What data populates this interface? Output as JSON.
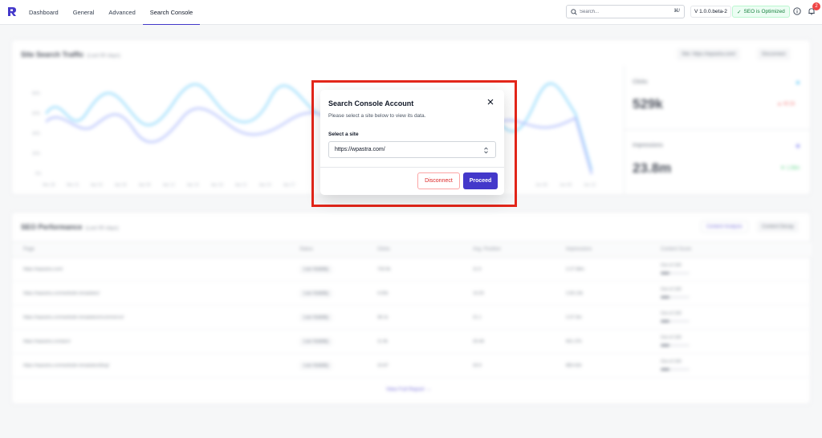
{
  "nav": {
    "tabs": [
      {
        "label": "Dashboard"
      },
      {
        "label": "General"
      },
      {
        "label": "Advanced"
      },
      {
        "label": "Search Console"
      }
    ],
    "search_placeholder": "Search...",
    "search_shortcut": "⌘/",
    "version": "V 1.0.0.beta-2",
    "seo_status": "SEO is Optimized",
    "notification_count": "2",
    "accent_color": "#4338ca"
  },
  "traffic": {
    "title": "Site Search Traffic",
    "subtitle": "(Last 90 days)",
    "site_pill": "Site: https://wpastra.com/",
    "disconnect_pill": "Disconnect",
    "y_ticks": [
      "80%",
      "60%",
      "40%",
      "20%",
      "0%"
    ],
    "x_ticks": [
      "Mar 28",
      "Mar 31",
      "Apr 03",
      "Apr 06",
      "Apr 09",
      "Apr 12",
      "Apr 15",
      "Apr 18",
      "Apr 21",
      "Apr 24",
      "Apr 27",
      "Jun 06",
      "Jun 09",
      "Jun 12"
    ],
    "clicks_label": "Clicks",
    "clicks_value": "529k",
    "clicks_delta": "▲ 40.2k",
    "impressions_label": "Impressions",
    "impressions_value": "23.8m",
    "impressions_delta": "▼ 1.08m"
  },
  "performance": {
    "title": "SEO Performance",
    "subtitle": "(Last 90 days)",
    "tab_content": "Content Analysis",
    "tab_decay": "Content Decay",
    "headers": [
      "Page",
      "Status",
      "Clicks",
      "Avg. Position",
      "Impressions",
      "Content Score"
    ],
    "rows": [
      {
        "page": "https://wpastra.com/",
        "status": "Low Visibility",
        "clicks": "733.0k",
        "position": "11.9",
        "impressions": "2.27.58m",
        "score": "Out of 100"
      },
      {
        "page": "https://wpastra.com/website-templates/",
        "status": "Low Visibility",
        "clicks": "4.50k",
        "position": "14.25",
        "impressions": "2.83.13k",
        "score": "Out of 100"
      },
      {
        "page": "https://wpastra.com/website-templates/ecommerce/",
        "status": "Low Visibility",
        "clicks": "38.1k",
        "position": "21.1",
        "impressions": "2.07.9m",
        "score": "Out of 100"
      },
      {
        "page": "https://wpastra.com/pro/",
        "status": "Low Visibility",
        "clicks": "11.9k",
        "position": "33.48",
        "impressions": "661.37k",
        "score": "Out of 100"
      },
      {
        "page": "https://wpastra.com/website-templates/blog/",
        "status": "Low Visibility",
        "clicks": "10.87",
        "position": "33.9",
        "impressions": "883.62k",
        "score": "Out of 100"
      }
    ],
    "view_report": "View Full Report"
  },
  "modal": {
    "title": "Search Console Account",
    "description": "Please select a site below to view its data.",
    "field_label": "Select a site",
    "selected_site": "https://wpastra.com/",
    "disconnect_label": "Disconnect",
    "proceed_label": "Proceed",
    "highlight_color": "#e3261a"
  }
}
